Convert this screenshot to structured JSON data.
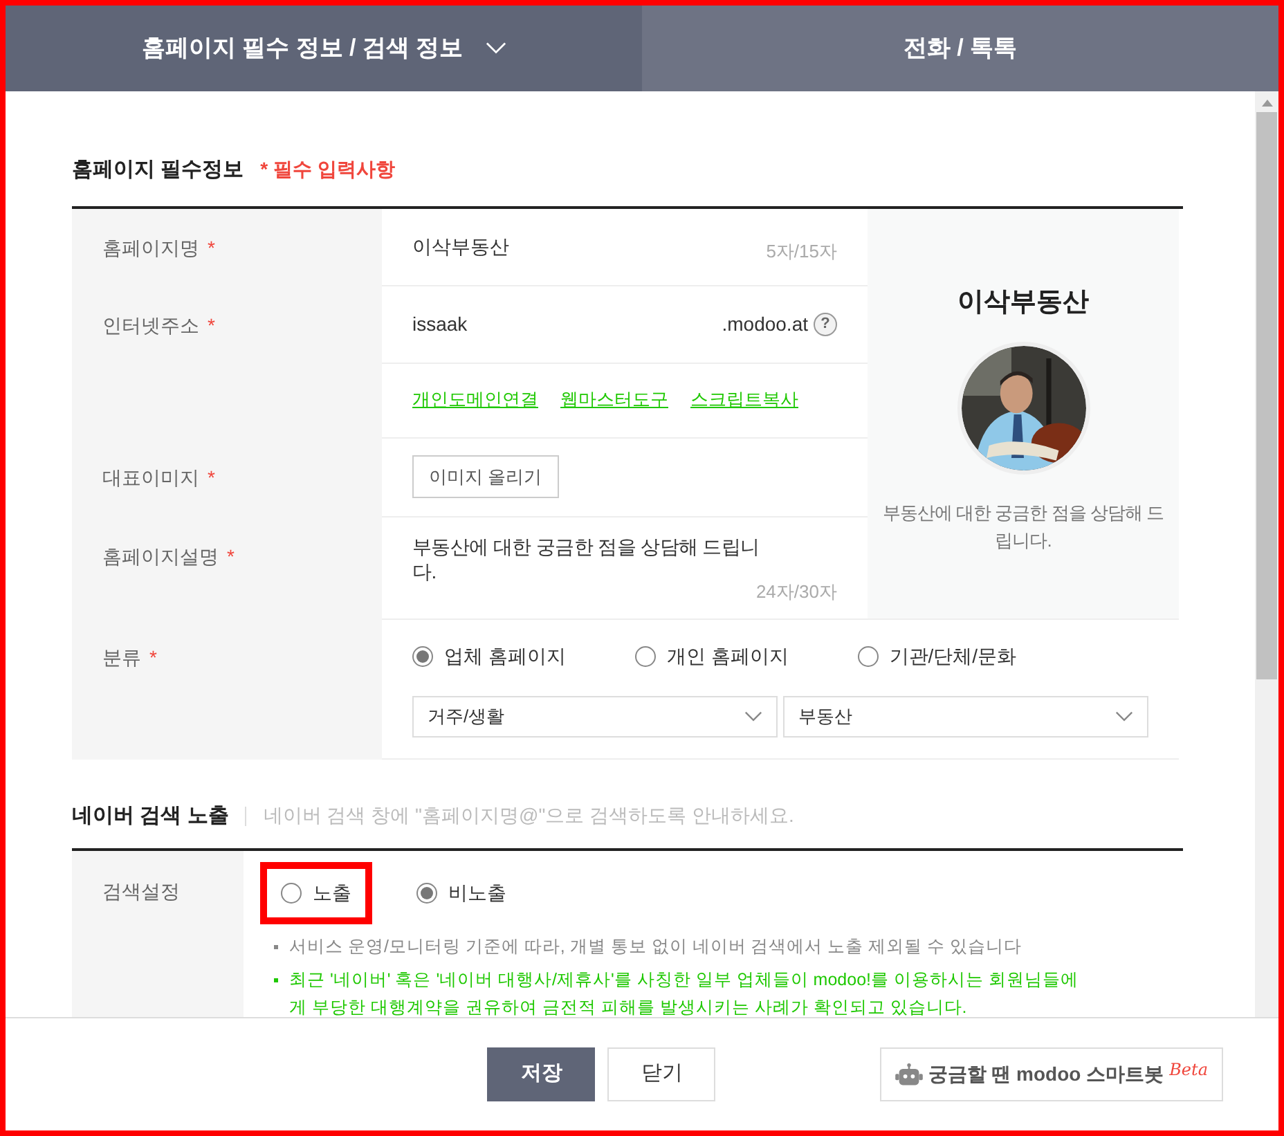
{
  "tabs": [
    {
      "label": "홈페이지 필수 정보 / 검색 정보",
      "selected": true,
      "dropdown": true
    },
    {
      "label": "전화 / 톡톡",
      "selected": false,
      "dropdown": false
    }
  ],
  "required_section": {
    "title": "홈페이지 필수정보",
    "note": "* 필수 입력사항",
    "name_row": {
      "label": "홈페이지명",
      "required_mark": "*",
      "value": "이삭부동산",
      "count": "5자/15자"
    },
    "address_row": {
      "label": "인터넷주소",
      "required_mark": "*",
      "value": "issaak",
      "suffix": ".modoo.at",
      "help": "?",
      "links": [
        "개인도메인연결",
        "웹마스터도구",
        "스크립트복사"
      ]
    },
    "image_row": {
      "label": "대표이미지",
      "required_mark": "*",
      "button": "이미지 올리기"
    },
    "description_row": {
      "label": "홈페이지설명",
      "required_mark": "*",
      "value": "부동산에 대한 궁금한 점을 상담해 드립니다.",
      "count": "24자/30자"
    },
    "category_row": {
      "label": "분류",
      "required_mark": "*",
      "options": [
        {
          "label": "업체 홈페이지",
          "selected": true
        },
        {
          "label": "개인 홈페이지",
          "selected": false
        },
        {
          "label": "기관/단체/문화",
          "selected": false
        }
      ],
      "selects": [
        "거주/생활",
        "부동산"
      ]
    },
    "preview": {
      "title": "이삭부동산",
      "description": "부동산에 대한 궁금한 점을 상담해 드립니다."
    }
  },
  "search_section": {
    "title": "네이버 검색 노출",
    "hint": "네이버 검색 창에 \"홈페이지명@\"으로 검색하도록 안내하세요.",
    "row": {
      "label": "검색설정",
      "options": [
        {
          "label": "노출",
          "selected": false,
          "highlighted": true
        },
        {
          "label": "비노출",
          "selected": true,
          "highlighted": false
        }
      ],
      "notes": [
        {
          "text": "서비스 운영/모니터링 기준에 따라, 개별 통보 없이 네이버 검색에서 노출 제외될 수 있습니다",
          "color": "#888888"
        },
        {
          "text": "최근 '네이버' 혹은 '네이버 대행사/제휴사'를 사칭한 일부 업체들이 modoo!를 이용하시는 회원님들에게 부당한 대행계약을 권유하여 금전적 피해를 발생시키는 사례가 확인되고 있습니다.",
          "color": "#1ec800"
        }
      ]
    }
  },
  "footer": {
    "buttons": [
      {
        "label": "저장",
        "kind": "primary"
      },
      {
        "label": "닫기",
        "kind": "secondary"
      }
    ],
    "bot": {
      "label": "궁금할 땐 modoo 스마트봇",
      "badge": "Beta"
    }
  }
}
